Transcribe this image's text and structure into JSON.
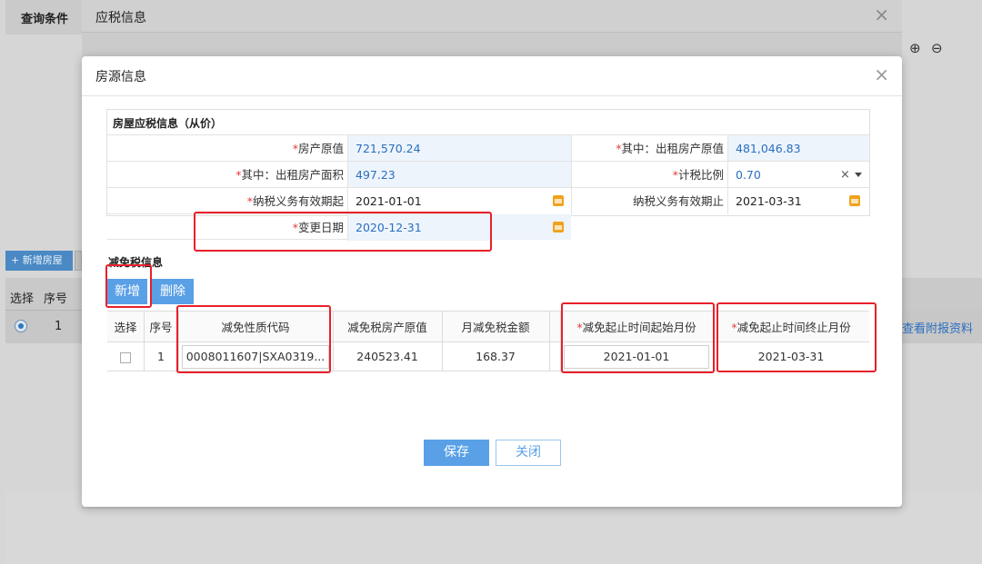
{
  "background": {
    "query_title": "查询条件",
    "add_house_button": "+ 新增房屋",
    "table_headers": {
      "select": "选择",
      "seq": "序号"
    },
    "row": {
      "seq": "1"
    },
    "attach_link": "查看附报资料",
    "zoom_in_icon": "⊕",
    "zoom_out_icon": "⊖"
  },
  "outer_dialog": {
    "title": "应税信息",
    "close": "×"
  },
  "inner_dialog": {
    "title": "房源信息",
    "close": "×",
    "section_title": "房屋应税信息（从价）",
    "fields": {
      "original_value_label": "房产原值",
      "original_value": "721,570.24",
      "rental_original_label": "其中：出租房产原值",
      "rental_original": "481,046.83",
      "rental_area_label": "其中：出租房产面积",
      "rental_area": "497.23",
      "tax_ratio_label": "计税比例",
      "tax_ratio": "0.70",
      "tax_ratio_clear": "×",
      "start_label": "纳税义务有效期起",
      "start": "2021-01-01",
      "end_label": "纳税义务有效期止",
      "end": "2021-03-31",
      "change_date_label": "变更日期",
      "change_date": "2020-12-31",
      "required_mark": "*"
    },
    "reduce_title": "减免税信息",
    "add_button": "新增",
    "delete_button": "删除",
    "table": {
      "headers": [
        "选择",
        "序号",
        "减免性质代码",
        "减免税房产原值",
        "月减免税金额",
        "减免起止时间起始月份",
        "减免起止时间终止月份"
      ],
      "rows": [
        {
          "seq": "1",
          "code": "0008011607|SXA0319...",
          "original_value": "240523.41",
          "monthly_amount": "168.37",
          "start_month": "2021-01-01",
          "end_month": "2021-03-31"
        }
      ]
    },
    "save_button": "保存",
    "close_button": "关闭"
  },
  "colors": {
    "accent": "#5aa0e6",
    "link": "#2a6fc0",
    "required": "#e23b3b",
    "annotation": "#e8202a",
    "calendar": "#f0a21d"
  }
}
